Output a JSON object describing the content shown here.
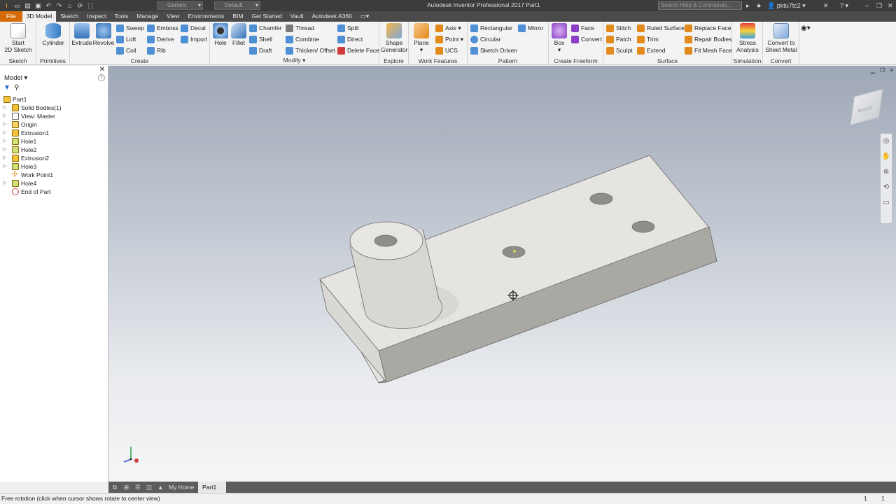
{
  "app": {
    "title": "Autodesk Inventor Professional 2017",
    "document": "Part1",
    "search_placeholder": "Search Help & Commands...",
    "user": "pktu7tc2",
    "material": "Generic",
    "appearance": "Default"
  },
  "menu": {
    "tabs": [
      "File",
      "3D Model",
      "Sketch",
      "Inspect",
      "Tools",
      "Manage",
      "View",
      "Environments",
      "BIM",
      "Get Started",
      "Vault",
      "Autodesk A360"
    ],
    "active": "3D Model"
  },
  "ribbon": {
    "sketch": {
      "label": "Sketch",
      "start": "Start",
      "start2": "2D Sketch"
    },
    "primitives": {
      "label": "Primitives",
      "cylinder": "Cylinder"
    },
    "create": {
      "label": "Create",
      "extrude": "Extrude",
      "revolve": "Revolve",
      "sweep": "Sweep",
      "loft": "Loft",
      "coil": "Coil",
      "emboss": "Emboss",
      "derive": "Derive",
      "rib": "Rib",
      "decal": "Decal",
      "import": "Import"
    },
    "modify": {
      "label": "Modify",
      "hole": "Hole",
      "fillet": "Fillet",
      "chamfer": "Chamfer",
      "shell": "Shell",
      "draft": "Draft",
      "thread": "Thread",
      "combine": "Combine",
      "thicken": "Thicken/ Offset",
      "split": "Split",
      "direct": "Direct",
      "delete_face": "Delete Face"
    },
    "explore": {
      "label": "Explore",
      "shape1": "Shape",
      "shape2": "Generator"
    },
    "work_features": {
      "label": "Work Features",
      "plane": "Plane",
      "axis": "Axis",
      "point": "Point",
      "ucs": "UCS"
    },
    "pattern": {
      "label": "Pattern",
      "rectangular": "Rectangular",
      "circular": "Circular",
      "sketch_driven": "Sketch Driven",
      "mirror": "Mirror"
    },
    "freeform": {
      "label": "Create Freeform",
      "box": "Box",
      "face": "Face",
      "convert": "Convert"
    },
    "surface": {
      "label": "Surface",
      "stitch": "Stitch",
      "patch": "Patch",
      "sculpt": "Sculpt",
      "ruled": "Ruled Surface",
      "trim": "Trim",
      "extend": "Extend",
      "replace": "Replace Face",
      "repair": "Repair Bodies",
      "fit": "Fit Mesh Face"
    },
    "simulation": {
      "label": "Simulation",
      "stress1": "Stress",
      "stress2": "Analysis"
    },
    "convert": {
      "label": "Convert",
      "c1": "Convert to",
      "c2": "Sheet Metal"
    }
  },
  "browser": {
    "title": "Model",
    "items": [
      {
        "label": "Part1"
      },
      {
        "label": "Solid Bodies(1)"
      },
      {
        "label": "View: Master"
      },
      {
        "label": "Origin"
      },
      {
        "label": "Extrusion1"
      },
      {
        "label": "Hole1"
      },
      {
        "label": "Hole2"
      },
      {
        "label": "Extrusion2"
      },
      {
        "label": "Hole3"
      },
      {
        "label": "Work Point1"
      },
      {
        "label": "Hole4"
      },
      {
        "label": "End of Part"
      }
    ]
  },
  "viewcube": {
    "face": "RIGHT"
  },
  "doc_tabs": {
    "home": "My Home",
    "part": "Part1"
  },
  "status": {
    "text": "Free rotation (click when cursor shows rotate to center view)",
    "n1": "1",
    "n2": "1"
  }
}
